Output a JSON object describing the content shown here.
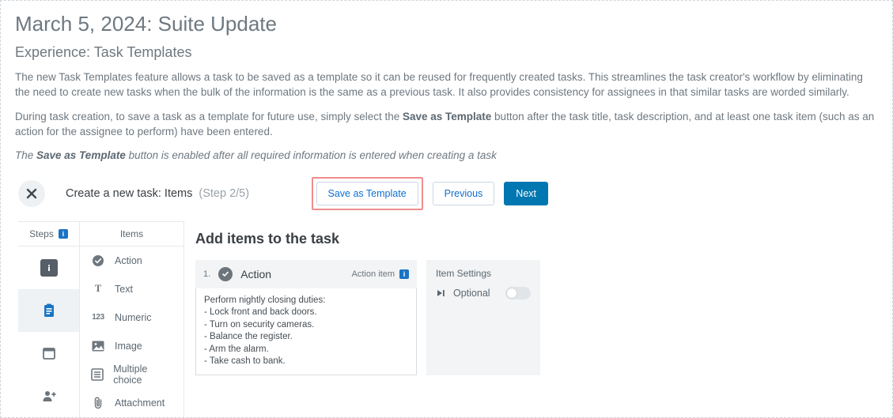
{
  "heading": "March 5, 2024: Suite Update",
  "subheading": "Experience: Task Templates",
  "para1": "The new Task Templates feature allows a task to be saved as a template so it can be reused for frequently created tasks. This streamlines the task creator's workflow by eliminating the need to create new tasks when the bulk of the information is the same as a previous task. It also provides consistency for assignees in that similar tasks are worded similarly.",
  "para2_a": "During task creation, to save a task as a template for future use, simply select the ",
  "para2_bold": "Save as Template",
  "para2_b": " button after the task title, task description, and at least one task item (such as an action for the assignee to perform) have been entered.",
  "caption_a": "The ",
  "caption_bold": "Save as Template",
  "caption_b": " button is enabled after all required information is entered when creating a task",
  "wizard": {
    "title": "Create a new task: Items",
    "step_label": "(Step 2/5)",
    "save_template": "Save as Template",
    "previous": "Previous",
    "next": "Next"
  },
  "cols": {
    "steps": "Steps",
    "items": "Items"
  },
  "item_types": {
    "action": "Action",
    "text": "Text",
    "numeric": "Numeric",
    "image": "Image",
    "multiple_choice": "Multiple choice",
    "attachment": "Attachment"
  },
  "main": {
    "title": "Add items to the task",
    "item_number": "1.",
    "item_label": "Action",
    "meta_label": "Action item",
    "body": "Perform nightly closing duties:\n- Lock front and back doors.\n- Turn on security cameras.\n- Balance the register.\n- Arm the alarm.\n- Take cash to bank.",
    "settings_title": "Item Settings",
    "optional_label": "Optional"
  }
}
